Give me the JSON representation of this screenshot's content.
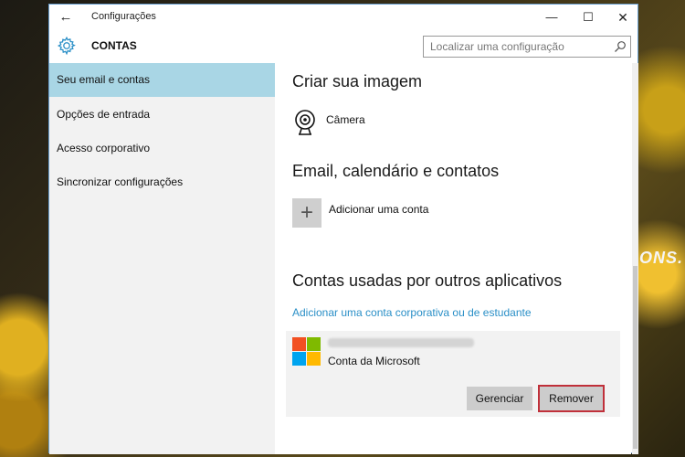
{
  "window": {
    "title": "Configurações",
    "back_glyph": "←",
    "minimize_glyph": "—",
    "maximize_glyph": "☐",
    "close_glyph": "✕"
  },
  "header": {
    "icon": "gear-icon",
    "title": "CONTAS",
    "search_placeholder": "Localizar uma configuração"
  },
  "sidebar": {
    "items": [
      {
        "label": "Seu email e contas",
        "active": true
      },
      {
        "label": "Opções de entrada",
        "active": false
      },
      {
        "label": "Acesso corporativo",
        "active": false
      },
      {
        "label": "Sincronizar configurações",
        "active": false
      }
    ]
  },
  "content": {
    "section_image": {
      "title": "Criar sua imagem",
      "camera_label": "Câmera"
    },
    "section_email": {
      "title": "Email, calendário e contatos",
      "add_glyph": "+",
      "add_label": "Adicionar uma conta"
    },
    "section_other": {
      "title": "Contas usadas por outros aplicativos",
      "link": "Adicionar uma conta corporativa ou de estudante",
      "account": {
        "type": "Conta da Microsoft",
        "manage_label": "Gerenciar",
        "remove_label": "Remover"
      }
    }
  },
  "desktop": {
    "wallpaper_text": "ONS."
  },
  "colors": {
    "accent": "#2a8fc7",
    "sidebar_active": "#a9d6e5",
    "remove_border": "#c0303a",
    "ms_red": "#f25022",
    "ms_green": "#7fba00",
    "ms_blue": "#00a4ef",
    "ms_yellow": "#ffb900"
  }
}
